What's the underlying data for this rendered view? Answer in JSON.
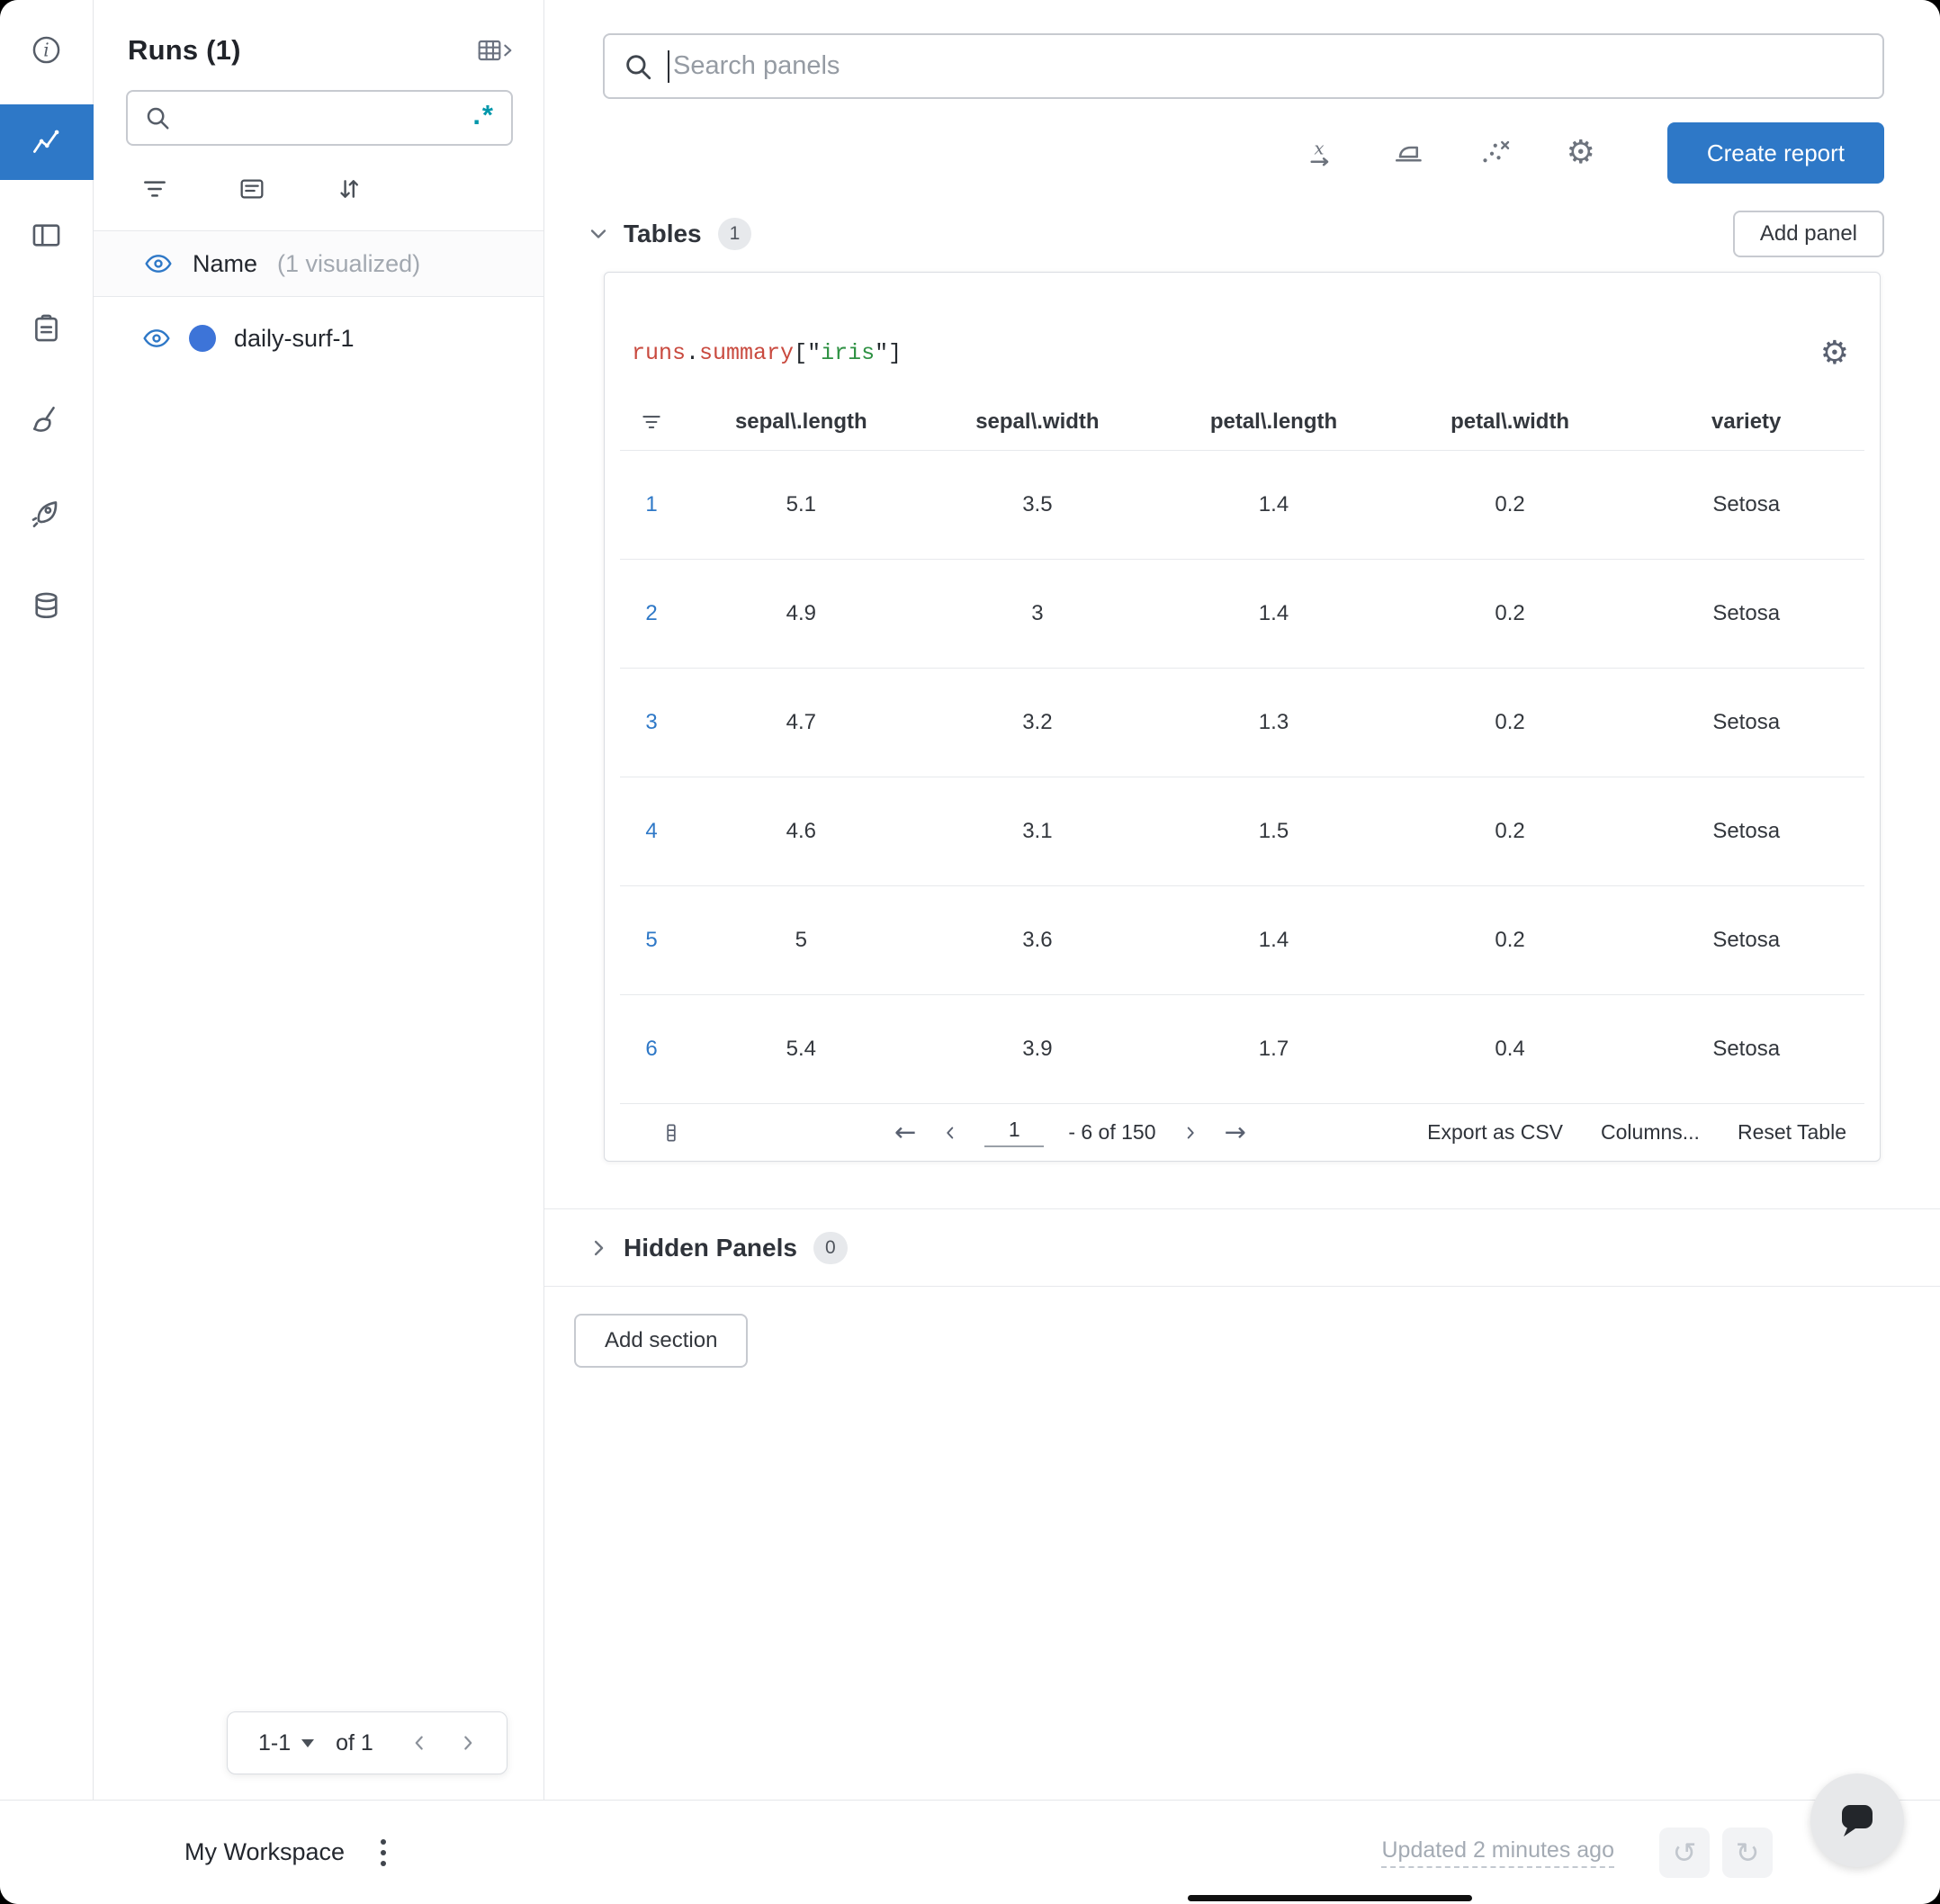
{
  "colors": {
    "accent_blue": "#2e78c7",
    "run_dot_blue": "#3d74d8",
    "regex_teal": "#0097ab",
    "code_red": "#c94a3f",
    "code_green": "#2e9143"
  },
  "rail": {
    "items": [
      {
        "icon": "info-icon",
        "active": false
      },
      {
        "icon": "line-chart-icon",
        "active": true
      },
      {
        "icon": "panel-layout-icon",
        "active": false
      },
      {
        "icon": "clipboard-icon",
        "active": false
      },
      {
        "icon": "broom-icon",
        "active": false
      },
      {
        "icon": "rocket-icon",
        "active": false
      },
      {
        "icon": "database-icon",
        "active": false
      }
    ]
  },
  "sidebar": {
    "title": "Runs (1)",
    "search": {
      "value": "",
      "placeholder": "",
      "regex_label": ".*"
    },
    "header": {
      "name_label": "Name",
      "annotation": "(1 visualized)"
    },
    "runs": [
      {
        "label": "daily-surf-1"
      }
    ],
    "pagination": {
      "range_label": "1-1",
      "of_label": "of 1"
    }
  },
  "topbar": {
    "search_placeholder": "Search panels",
    "create_report_label": "Create report"
  },
  "tables_section": {
    "title": "Tables",
    "count": "1",
    "add_panel_label": "Add panel"
  },
  "panel": {
    "code_title": {
      "obj": "runs",
      "dot": ".",
      "prop": "summary",
      "open": "[\"",
      "key": "iris",
      "close": "\"]"
    },
    "table": {
      "columns": [
        "sepal\\.length",
        "sepal\\.width",
        "petal\\.length",
        "petal\\.width",
        "variety"
      ],
      "rows": [
        {
          "index": "1",
          "cells": [
            "5.1",
            "3.5",
            "1.4",
            "0.2",
            "Setosa"
          ]
        },
        {
          "index": "2",
          "cells": [
            "4.9",
            "3",
            "1.4",
            "0.2",
            "Setosa"
          ]
        },
        {
          "index": "3",
          "cells": [
            "4.7",
            "3.2",
            "1.3",
            "0.2",
            "Setosa"
          ]
        },
        {
          "index": "4",
          "cells": [
            "4.6",
            "3.1",
            "1.5",
            "0.2",
            "Setosa"
          ]
        },
        {
          "index": "5",
          "cells": [
            "5",
            "3.6",
            "1.4",
            "0.2",
            "Setosa"
          ]
        },
        {
          "index": "6",
          "cells": [
            "5.4",
            "3.9",
            "1.7",
            "0.4",
            "Setosa"
          ]
        }
      ],
      "footer": {
        "page_value": "1",
        "range_label": "- 6 of 150",
        "export_label": "Export as CSV",
        "columns_label": "Columns...",
        "reset_label": "Reset Table"
      }
    }
  },
  "hidden_section": {
    "title": "Hidden Panels",
    "count": "0"
  },
  "add_section_label": "Add section",
  "statusbar": {
    "workspace_label": "My Workspace",
    "updated_label": "Updated 2 minutes ago"
  }
}
